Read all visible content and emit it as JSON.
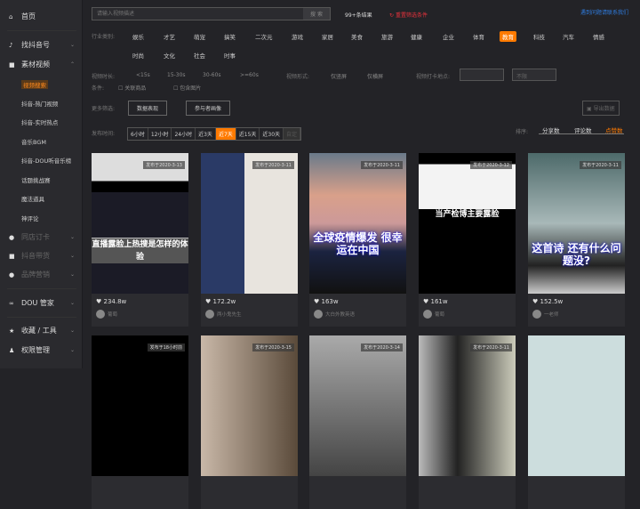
{
  "sidebar": {
    "home": "首页",
    "find_account": "找抖音号",
    "material": "素材视频",
    "subs": [
      "视频搜索",
      "抖音-热门视频",
      "抖音-实时热点",
      "音乐BGM",
      "抖音-DOU听音乐榜",
      "话题挑战赛",
      "魔法道具",
      "神评论"
    ],
    "locked": [
      "同店订卡",
      "抖音带货",
      "品牌营销"
    ],
    "dou": "DOU 管家",
    "fav": "收藏 / 工具",
    "perm": "权限管理"
  },
  "search": {
    "placeholder": "请输入视频描述",
    "button": "搜 索",
    "result_count": "99+条结果",
    "reset": "重置筛选条件",
    "help": "遇到问题请联系我们"
  },
  "filters": {
    "industry_label": "行业类别:",
    "industries": [
      "娱乐",
      "才艺",
      "萌宠",
      "搞笑",
      "二次元",
      "游戏",
      "家居",
      "美食",
      "旅游",
      "健康",
      "企业",
      "体育",
      "教育",
      "科技",
      "汽车",
      "情感",
      "时尚",
      "文化",
      "社会",
      "时事"
    ],
    "active_industry": "教育",
    "duration_label": "视频时长:",
    "durations": [
      "<15s",
      "15-30s",
      "30-60s",
      ">=60s"
    ],
    "format_label": "视频形式:",
    "formats": [
      "仅竖屏",
      "仅横屏"
    ],
    "location_label": "视频打卡地点:",
    "location_value": "",
    "location_limit": "不限",
    "condition_label": "条件:",
    "conditions": [
      "关联商品",
      "包含图片"
    ],
    "more_label": "更多筛选:",
    "more": [
      "数据表现",
      "参与者画像"
    ],
    "export": "导出数据",
    "time_label": "发布时间:",
    "times": [
      "6小时",
      "12小时",
      "24小时",
      "近3天",
      "近7天",
      "近15天",
      "近30天",
      "自定"
    ],
    "active_time": "近7天",
    "sort_label": "排序:",
    "sorts": [
      "分享数",
      "评论数",
      "点赞数"
    ],
    "active_sort": "点赞数"
  },
  "accent": "#ff7a00",
  "videos": [
    {
      "date": "发布于2020-3-13",
      "likes": "234.8w",
      "author": "葡萄",
      "caption": "直播露脸上热搜是怎样的体验"
    },
    {
      "date": "发布于2020-3-11",
      "likes": "172.2w",
      "author": "两小鬼先生",
      "caption": ""
    },
    {
      "date": "发布于2020-3-11",
      "likes": "163w",
      "author": "大白外教英语",
      "caption": "全球疫情爆发 很幸运在中国"
    },
    {
      "date": "发布于2020-3-12",
      "likes": "161w",
      "author": "葡萄",
      "caption": "当产检博主要露脸"
    },
    {
      "date": "发布于2020-3-11",
      "likes": "152.5w",
      "author": "一老师",
      "caption": "这首诗 还有什么问题没?"
    },
    {
      "date": "发布于18小时前"
    },
    {
      "date": "发布于2020-3-15"
    },
    {
      "date": "发布于2020-3-14"
    },
    {
      "date": "发布于2020-3-11"
    },
    {
      "date": ""
    }
  ]
}
